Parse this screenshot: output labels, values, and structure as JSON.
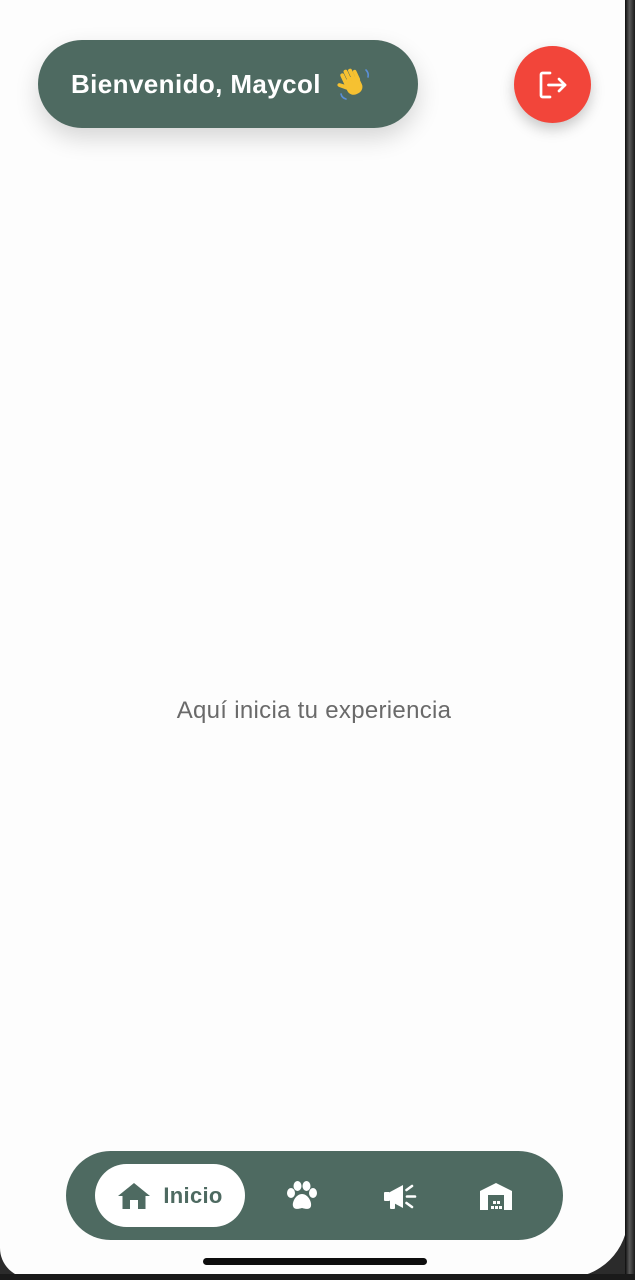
{
  "header": {
    "welcome_text": "Bienvenido, Maycol",
    "wave_icon": "waving-hand-emoji",
    "logout_icon": "logout-icon",
    "logout_color": "#f2453a",
    "pill_color": "#4e6a61"
  },
  "main": {
    "message": "Aquí inicia tu experiencia"
  },
  "bottom_nav": {
    "items": [
      {
        "label": "Inicio",
        "icon": "home-icon",
        "active": true
      },
      {
        "label": "",
        "icon": "paw-icon",
        "active": false
      },
      {
        "label": "",
        "icon": "megaphone-icon",
        "active": false
      },
      {
        "label": "",
        "icon": "shelter-icon",
        "active": false
      }
    ],
    "bar_color": "#4e6a61",
    "active_bg": "#ffffff"
  }
}
